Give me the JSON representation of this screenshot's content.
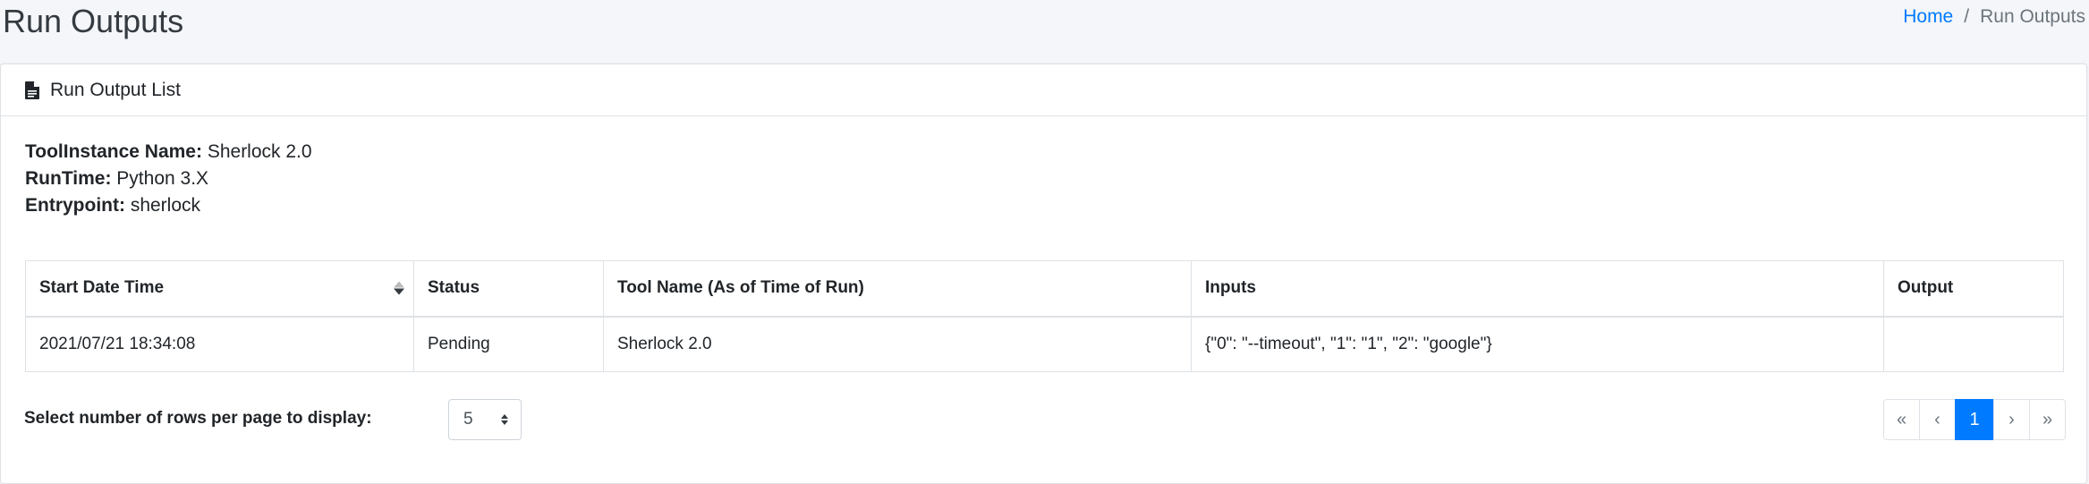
{
  "header": {
    "title": "Run Outputs",
    "breadcrumb": {
      "home": "Home",
      "separator": "/",
      "current": "Run Outputs"
    }
  },
  "card": {
    "title": "Run Output List",
    "icon": "file-icon",
    "info": {
      "tool_instance_label": "ToolInstance Name:",
      "tool_instance_value": "Sherlock 2.0",
      "runtime_label": "RunTime:",
      "runtime_value": "Python 3.X",
      "entrypoint_label": "Entrypoint:",
      "entrypoint_value": "sherlock"
    }
  },
  "table": {
    "columns": [
      "Start Date Time",
      "Status",
      "Tool Name (As of Time of Run)",
      "Inputs",
      "Output"
    ],
    "rows": [
      [
        "2021/07/21 18:34:08",
        "Pending",
        "Sherlock 2.0",
        "{\"0\": \"--timeout\", \"1\": \"1\", \"2\": \"google\"}",
        ""
      ]
    ]
  },
  "footer": {
    "rows_label": "Select number of rows per page to display:",
    "rows_value": "5",
    "pagination": {
      "first": "«",
      "prev": "‹",
      "page": "1",
      "next": "›",
      "last": "»"
    }
  },
  "colors": {
    "accent": "#007bff",
    "background": "#f4f6f9"
  }
}
